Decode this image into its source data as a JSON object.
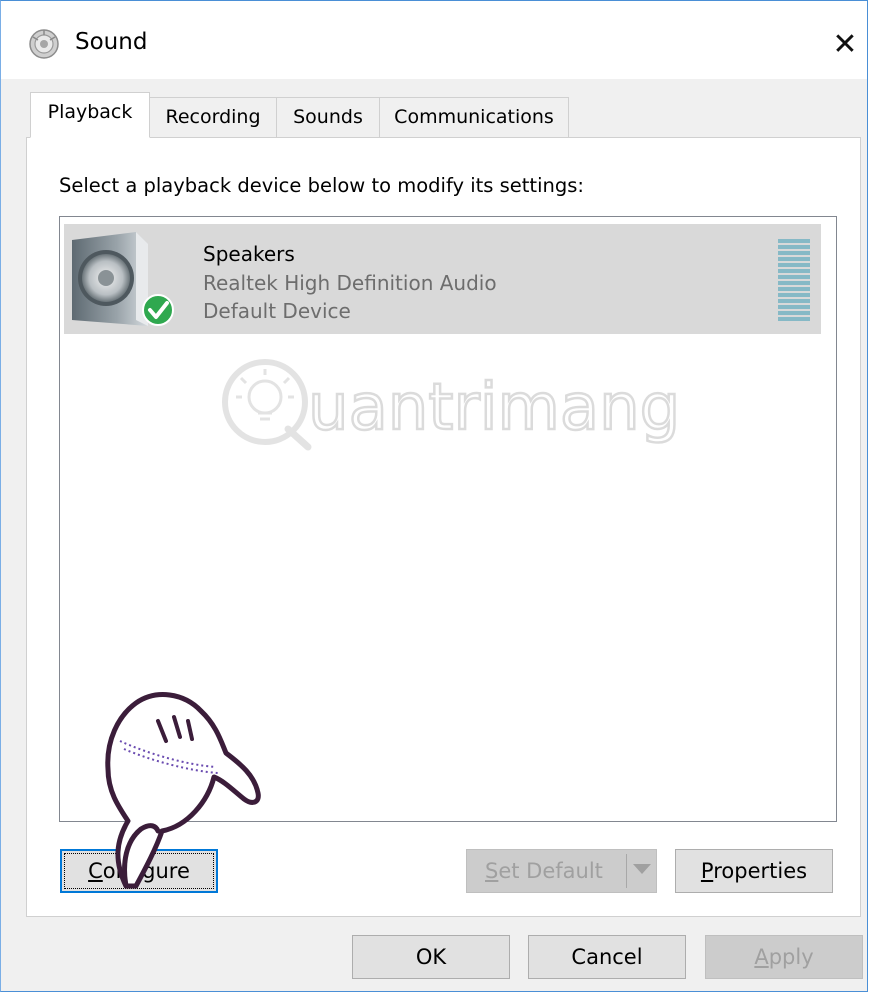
{
  "window": {
    "title": "Sound",
    "title_icon": "speaker-window-icon",
    "close_glyph": "✕"
  },
  "tabs": [
    {
      "label": "Playback",
      "active": true
    },
    {
      "label": "Recording",
      "active": false
    },
    {
      "label": "Sounds",
      "active": false
    },
    {
      "label": "Communications",
      "active": false
    }
  ],
  "playback": {
    "instruction": "Select a playback device below to modify its settings:",
    "devices": [
      {
        "name": "Speakers",
        "description": "Realtek High Definition Audio",
        "status": "Default Device",
        "icon": "speaker-icon",
        "status_icon": "green-check-icon",
        "selected": true
      }
    ],
    "buttons": {
      "configure": {
        "prefix": "",
        "mnemonic": "C",
        "rest": "onfigure"
      },
      "set_default": {
        "prefix": "",
        "mnemonic": "S",
        "rest": "et Default",
        "disabled": true
      },
      "properties": {
        "prefix": "",
        "mnemonic": "P",
        "rest": "roperties"
      }
    }
  },
  "watermark": {
    "text": "uantrimang"
  },
  "footer": {
    "ok": "OK",
    "cancel": "Cancel",
    "apply": {
      "mnemonic": "A",
      "rest": "pply",
      "disabled": true
    }
  },
  "colors": {
    "accent": "#0078d7",
    "selected_row": "#d9d9d9",
    "level_meter": "#86b9c6",
    "check_green": "#2fa84f"
  }
}
